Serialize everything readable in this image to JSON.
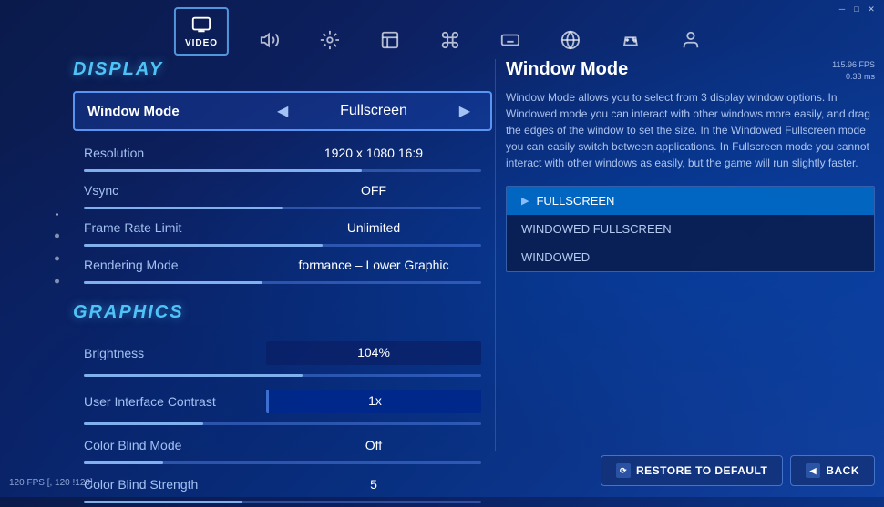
{
  "window": {
    "controls": [
      "─",
      "□",
      "✕"
    ]
  },
  "nav": {
    "items": [
      {
        "id": "video",
        "label": "VIDEO",
        "active": true
      },
      {
        "id": "audio",
        "label": "",
        "active": false
      },
      {
        "id": "gameplay",
        "label": "",
        "active": false
      },
      {
        "id": "interface",
        "label": "",
        "active": false
      },
      {
        "id": "controls2",
        "label": "",
        "active": false
      },
      {
        "id": "keyboard",
        "label": "",
        "active": false
      },
      {
        "id": "network",
        "label": "",
        "active": false
      },
      {
        "id": "controller",
        "label": "",
        "active": false
      },
      {
        "id": "profile",
        "label": "",
        "active": false
      }
    ],
    "active_label": "VIDEO"
  },
  "display": {
    "section_title": "DISPLAY",
    "settings": [
      {
        "id": "window_mode",
        "label": "Window Mode",
        "value": "Fullscreen",
        "type": "select",
        "active": true
      },
      {
        "id": "resolution",
        "label": "Resolution",
        "value": "1920 x 1080 16:9",
        "type": "select"
      },
      {
        "id": "vsync",
        "label": "Vsync",
        "value": "OFF",
        "type": "select"
      },
      {
        "id": "frame_rate_limit",
        "label": "Frame Rate Limit",
        "value": "Unlimited",
        "type": "select"
      },
      {
        "id": "rendering_mode",
        "label": "Rendering Mode",
        "value": "formance – Lower Graphic",
        "type": "select"
      }
    ]
  },
  "graphics": {
    "section_title": "GRAPHICS",
    "settings": [
      {
        "id": "brightness",
        "label": "Brightness",
        "value": "104%",
        "type": "slider",
        "fill_pct": 55
      },
      {
        "id": "ui_contrast",
        "label": "User Interface Contrast",
        "value": "1x",
        "type": "slider",
        "fill_pct": 30
      },
      {
        "id": "color_blind_mode",
        "label": "Color Blind Mode",
        "value": "Off",
        "type": "slider",
        "fill_pct": 20
      },
      {
        "id": "color_blind_strength",
        "label": "Color Blind Strength",
        "value": "5",
        "type": "slider",
        "fill_pct": 40
      }
    ]
  },
  "right_panel": {
    "title": "Window Mode",
    "description": "Window Mode allows you to select from 3 display window options. In Windowed mode you can interact with other windows more easily, and drag the edges of the window to set the size. In the Windowed Fullscreen mode you can easily switch between applications. In Fullscreen mode you cannot interact with other windows as easily, but the game will run slightly faster.",
    "fps": "115.96 FPS",
    "ms": "0.33 ms",
    "dropdown_options": [
      {
        "label": "FULLSCREEN",
        "selected": true
      },
      {
        "label": "WINDOWED FULLSCREEN",
        "selected": false
      },
      {
        "label": "WINDOWED",
        "selected": false
      }
    ]
  },
  "buttons": {
    "restore": "RESTORE TO DEFAULT",
    "back": "BACK"
  },
  "fps_counter": "120 FPS [, 120 !120]"
}
